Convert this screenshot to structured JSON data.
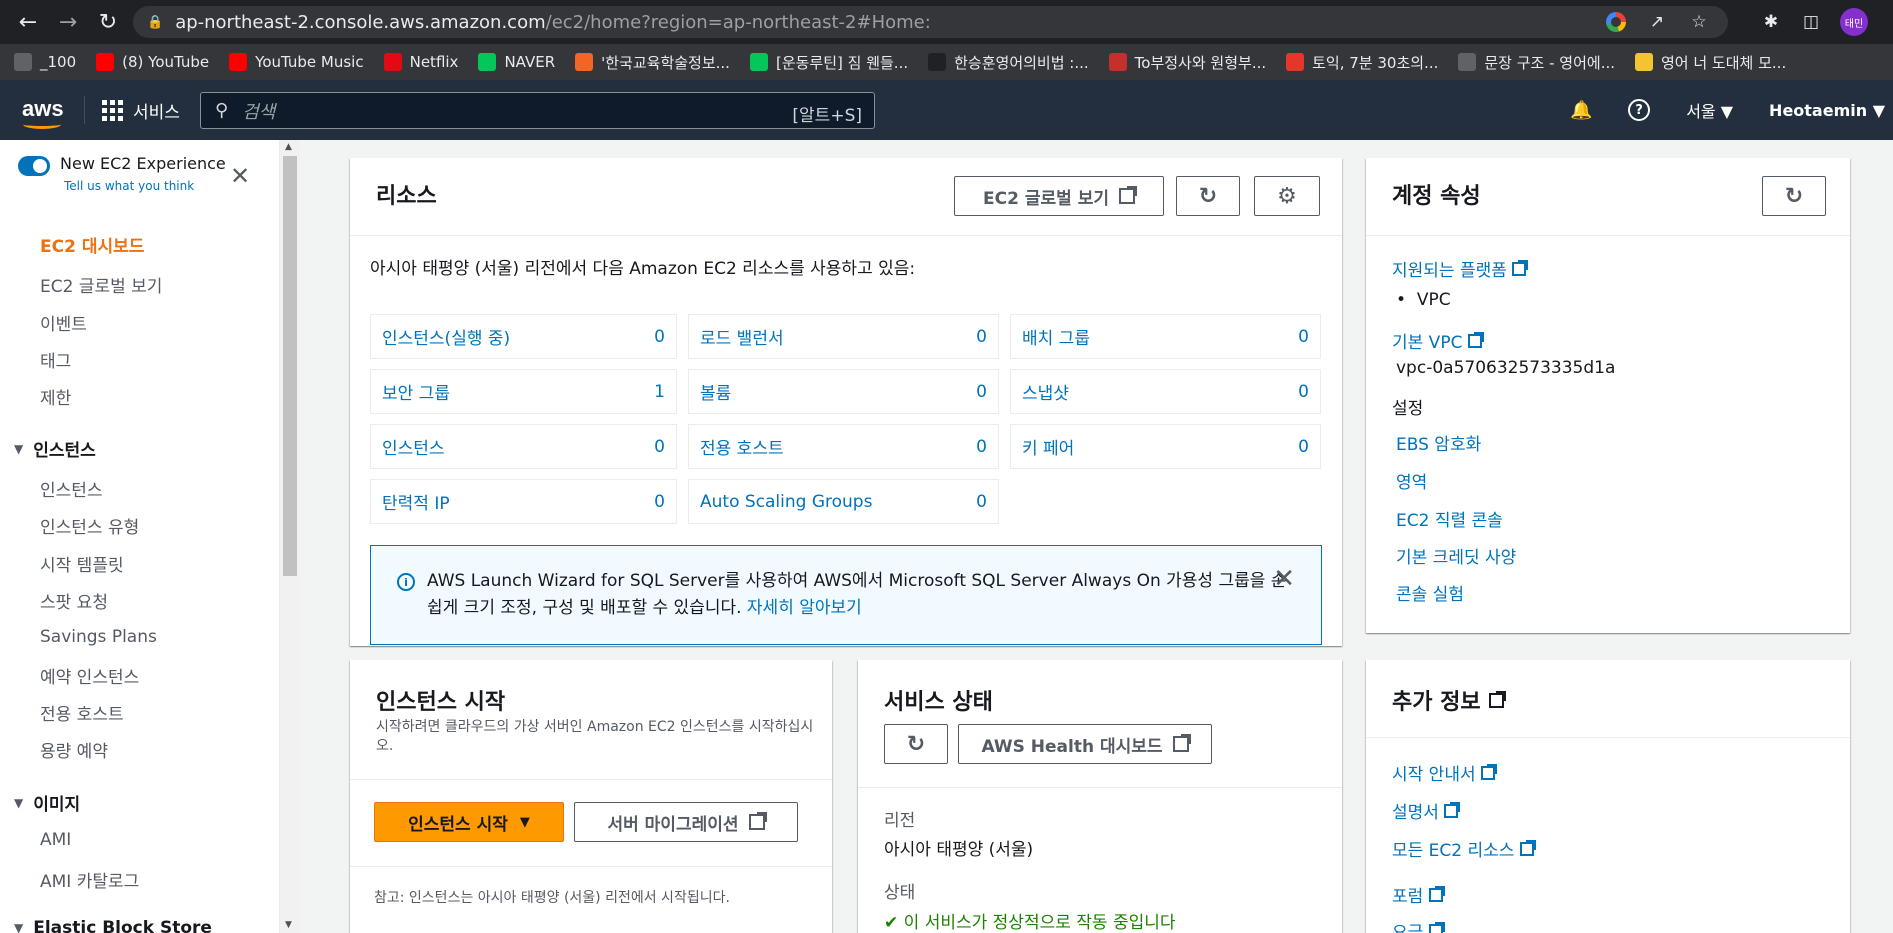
{
  "browser": {
    "url_host": "ap-northeast-2.console.aws.amazon.com",
    "url_path": "/ec2/home?region=ap-northeast-2#Home:",
    "avatar_text": "태민",
    "bookmarks": [
      {
        "label": "_100",
        "color": "#5f6368"
      },
      {
        "label": "(8) YouTube",
        "color": "#ff0000"
      },
      {
        "label": "YouTube Music",
        "color": "#ff0000"
      },
      {
        "label": "Netflix",
        "color": "#e50914"
      },
      {
        "label": "NAVER",
        "color": "#03c75a"
      },
      {
        "label": "'한국교육학술정보...",
        "color": "#f26522"
      },
      {
        "label": "[운동루틴] 짐 웬들...",
        "color": "#03c75a"
      },
      {
        "label": "한승훈영어의비법 :...",
        "color": "#202124"
      },
      {
        "label": "To부정사와 원형부...",
        "color": "#c4302b"
      },
      {
        "label": "토익, 7분 30초의...",
        "color": "#e5362c"
      },
      {
        "label": "문장 구조 - 영어에...",
        "color": "#5f6368"
      },
      {
        "label": "영어 너 도대체 모...",
        "color": "#f4c430"
      }
    ]
  },
  "aws_header": {
    "logo": "aws",
    "services": "서비스",
    "search_placeholder": "검색",
    "search_shortcut": "[알트+S]",
    "region": "서울 ▼",
    "user": "Heotaemin ▼"
  },
  "sidebar": {
    "toggle_title": "New EC2 Experience",
    "toggle_sub": "Tell us what you think",
    "items_top": [
      "EC2 대시보드",
      "EC2 글로벌 보기",
      "이벤트",
      "태그",
      "제한"
    ],
    "group_instances": "인스턴스",
    "items_instances": [
      "인스턴스",
      "인스턴스 유형",
      "시작 템플릿",
      "스팟 요청",
      "Savings Plans",
      "예약 인스턴스",
      "전용 호스트",
      "용량 예약"
    ],
    "group_images": "이미지",
    "items_images": [
      "AMI",
      "AMI 카탈로그"
    ],
    "group_ebs": "Elastic Block Store"
  },
  "resources": {
    "title": "리소스",
    "global_view_btn": "EC2 글로벌 보기",
    "intro": "아시아 태평양 (서울) 리전에서 다음 Amazon EC2 리소스를 사용하고 있음:",
    "cells": [
      {
        "label": "인스턴스(실행 중)",
        "value": "0"
      },
      {
        "label": "로드 밸런서",
        "value": "0"
      },
      {
        "label": "배치 그룹",
        "value": "0"
      },
      {
        "label": "보안 그룹",
        "value": "1"
      },
      {
        "label": "볼륨",
        "value": "0"
      },
      {
        "label": "스냅샷",
        "value": "0"
      },
      {
        "label": "인스턴스",
        "value": "0"
      },
      {
        "label": "전용 호스트",
        "value": "0"
      },
      {
        "label": "키 페어",
        "value": "0"
      },
      {
        "label": "탄력적 IP",
        "value": "0"
      },
      {
        "label": "Auto Scaling Groups",
        "value": "0"
      }
    ],
    "info_text": "AWS Launch Wizard for SQL Server를 사용하여 AWS에서 Microsoft SQL Server Always On 가용성 그룹을 손쉽게 크기 조정, 구성 및 배포할 수 있습니다.",
    "info_link": "자세히 알아보기"
  },
  "account": {
    "title": "계정 속성",
    "supported_platforms": "지원되는 플랫폼",
    "vpc_bullet": "VPC",
    "default_vpc": "기본 VPC",
    "vpc_id": "vpc-0a570632573335d1a",
    "settings": "설정",
    "links": [
      "EBS 암호화",
      "영역",
      "EC2 직렬 콘솔",
      "기본 크레딧 사양",
      "콘솔 실험"
    ]
  },
  "launch": {
    "title": "인스턴스 시작",
    "desc": "시작하려면 클라우드의 가상 서버인 Amazon EC2 인스턴스를 시작하십시오.",
    "launch_btn": "인스턴스 시작",
    "migrate_btn": "서버 마이그레이션",
    "note": "참고: 인스턴스는 아시아 태평양 (서울) 리전에서 시작됩니다."
  },
  "service_health": {
    "title": "서비스 상태",
    "health_btn": "AWS Health 대시보드",
    "region_label": "리전",
    "region_value": "아시아 태평양 (서울)",
    "status_label": "상태",
    "status_value": "이 서비스가 정상적으로 작동 중입니다"
  },
  "more_info": {
    "title": "추가 정보",
    "links": [
      "시작 안내서",
      "설명서",
      "모든 EC2 리소스",
      "포럼",
      "요금"
    ]
  }
}
